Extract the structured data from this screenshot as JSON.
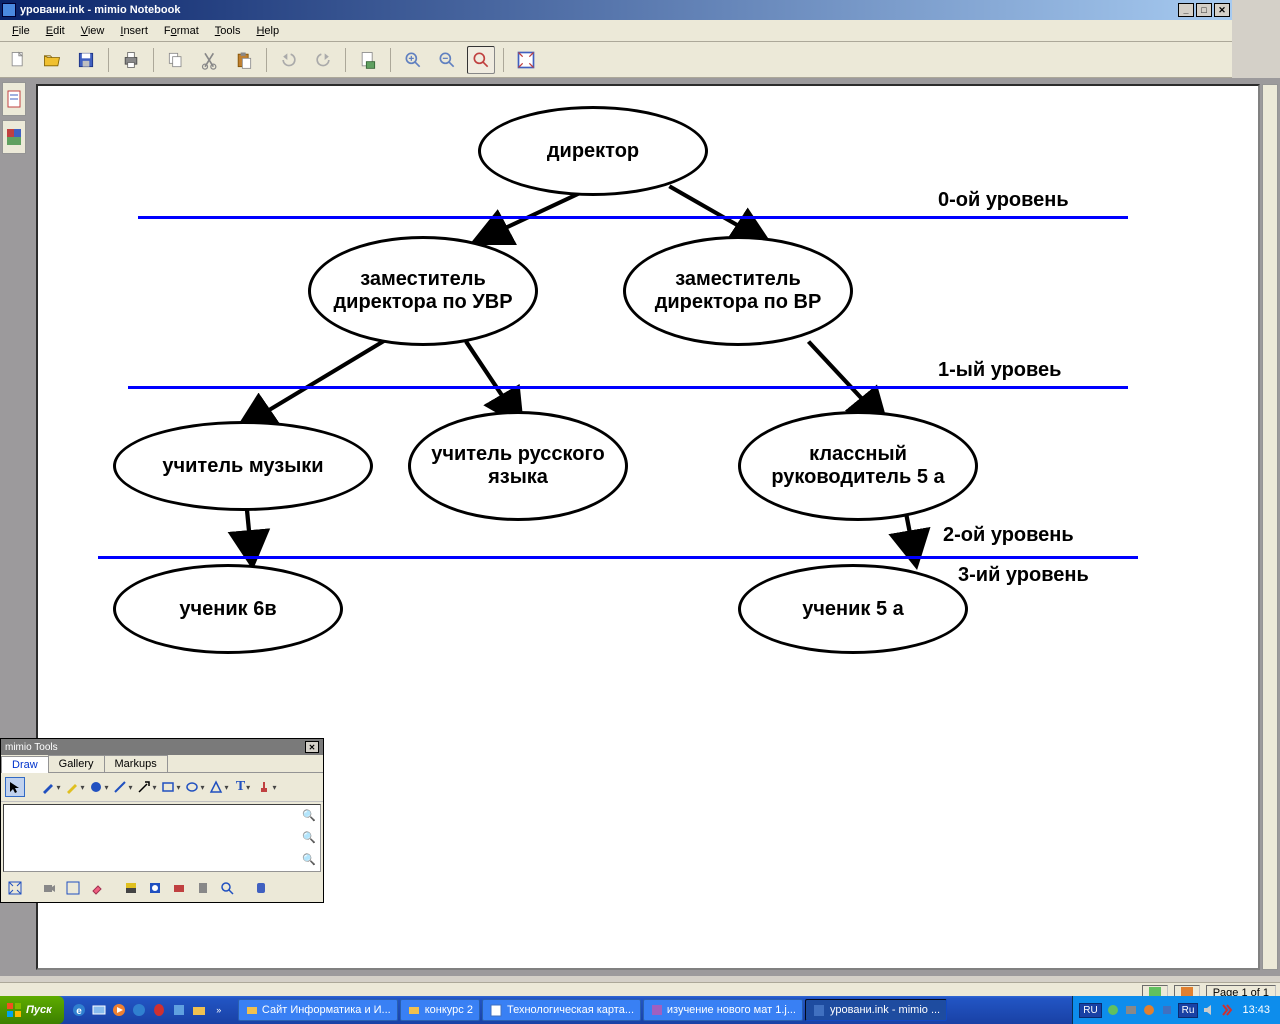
{
  "window": {
    "title": "уровани.ink - mimio Notebook"
  },
  "menu": {
    "file": "File",
    "edit": "Edit",
    "view": "View",
    "insert": "Insert",
    "format": "Format",
    "tools": "Tools",
    "help": "Help"
  },
  "diagram": {
    "nodes": {
      "director": "директор",
      "deputy_uvr": "заместитель директора по УВР",
      "deputy_vr": "заместитель директора по ВР",
      "music_teacher": "учитель музыки",
      "russian_teacher": "учитель русского языка",
      "class_head_5a": "классный руководитель 5 а",
      "student_6v": "ученик 6в",
      "student_5a": "ученик 5 а"
    },
    "levels": {
      "l0": "0-ой уровень",
      "l1": "1-ый уровеь",
      "l2": "2-ой уровень",
      "l3": "3-ий уровень"
    }
  },
  "tools_window": {
    "title": "mimio Tools",
    "tabs": {
      "draw": "Draw",
      "gallery": "Gallery",
      "markups": "Markups"
    }
  },
  "statusbar": {
    "page": "Page 1 of 1"
  },
  "taskbar": {
    "start": "Пуск",
    "items": {
      "site": "Сайт Информатика и И...",
      "konkurs": "конкурс 2",
      "tech": "Технологическая карта...",
      "study": "изучение нового мат 1.j...",
      "urovani": "уровани.ink - mimio ..."
    },
    "lang1": "RU",
    "lang2": "Ru",
    "clock": "13:43"
  }
}
